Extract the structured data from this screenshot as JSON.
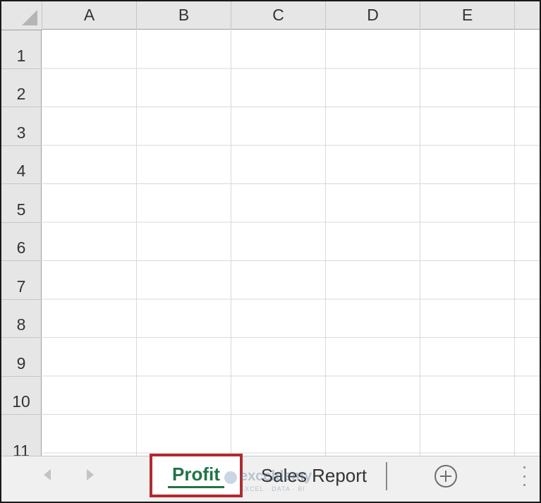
{
  "columns": [
    "A",
    "B",
    "C",
    "D",
    "E"
  ],
  "rows": [
    "1",
    "2",
    "3",
    "4",
    "5",
    "6",
    "7",
    "8",
    "9",
    "10",
    "11"
  ],
  "sheet_tabs": {
    "active": "Profit",
    "inactive": "Sales Report"
  },
  "colors": {
    "active_tab_text": "#217346",
    "highlight_border": "#b12a2f"
  },
  "watermark": {
    "name": "exceldemy",
    "tagline": "EXCEL · DATA · BI"
  },
  "icons": {
    "select_all": "select-all-triangle-icon",
    "scroll_left": "scroll-left-icon",
    "scroll_right": "scroll-right-icon",
    "new_sheet": "plus-circle-icon",
    "more": "vertical-ellipsis-icon"
  }
}
